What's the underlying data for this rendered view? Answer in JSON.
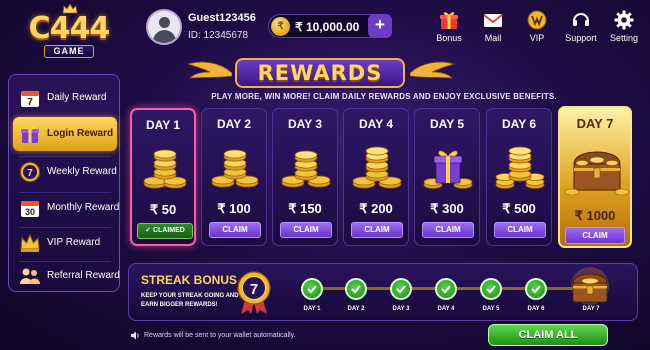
{
  "logo": {
    "main": "C444",
    "sub": "GAME"
  },
  "user": {
    "name": "Guest123456",
    "id": "ID: 12345678"
  },
  "balance": {
    "value": "₹ 10,000.00",
    "plus_label": "+",
    "coin_symbol": "₹"
  },
  "header_buttons": [
    {
      "label": "Bonus",
      "icon": "gift-icon"
    },
    {
      "label": "Mail",
      "icon": "mail-icon"
    },
    {
      "label": "VIP",
      "icon": "vip-icon"
    },
    {
      "label": "Support",
      "icon": "headset-icon"
    },
    {
      "label": "Setting",
      "icon": "gear-icon"
    }
  ],
  "sidebar": {
    "items": [
      {
        "label": "Daily Reward",
        "icon": "calendar-7-icon",
        "calendar_num": "7"
      },
      {
        "label": "Login Reward",
        "icon": "gift-icon",
        "active": true
      },
      {
        "label": "Weekly Reward",
        "icon": "badge-7-icon",
        "calendar_num": "7"
      },
      {
        "label": "Monthly Reward",
        "icon": "calendar-30-icon",
        "calendar_num": "30"
      },
      {
        "label": "VIP Reward",
        "icon": "crown-icon"
      },
      {
        "label": "Referral Reward",
        "icon": "users-icon"
      }
    ]
  },
  "title": "REWARDS",
  "subtitle": "PLAY MORE, WIN MORE! CLAIM DAILY REWARDS AND ENJOY EXCLUSIVE BENEFITS.",
  "days": [
    {
      "day": "DAY 1",
      "amount": "₹ 50",
      "status": "CLAIMED"
    },
    {
      "day": "DAY 2",
      "amount": "₹ 100",
      "status": "CLAIM"
    },
    {
      "day": "DAY 3",
      "amount": "₹ 150",
      "status": "CLAIM"
    },
    {
      "day": "DAY 4",
      "amount": "₹ 200",
      "status": "CLAIM"
    },
    {
      "day": "DAY 5",
      "amount": "₹ 300",
      "status": "CLAIM"
    },
    {
      "day": "DAY 6",
      "amount": "₹ 500",
      "status": "CLAIM"
    },
    {
      "day": "DAY 7",
      "amount": "₹ 1000",
      "status": "CLAIM"
    }
  ],
  "streak": {
    "title": "STREAK BONUS",
    "desc": "KEEP YOUR STREAK GOING AND EARN BIGGER REWARDS!",
    "badge_num": "7",
    "days": [
      "DAY 1",
      "DAY 2",
      "DAY 3",
      "DAY 4",
      "DAY 5",
      "DAY 6",
      "DAY 7"
    ]
  },
  "footer": {
    "note": "Rewards will be sent to your wallet automatically.",
    "claim_all": "CLAIM ALL"
  },
  "colors": {
    "gold": "#ffd75e",
    "purple": "#6b34cc",
    "green": "#23891c",
    "pink": "#ff5aa8"
  }
}
